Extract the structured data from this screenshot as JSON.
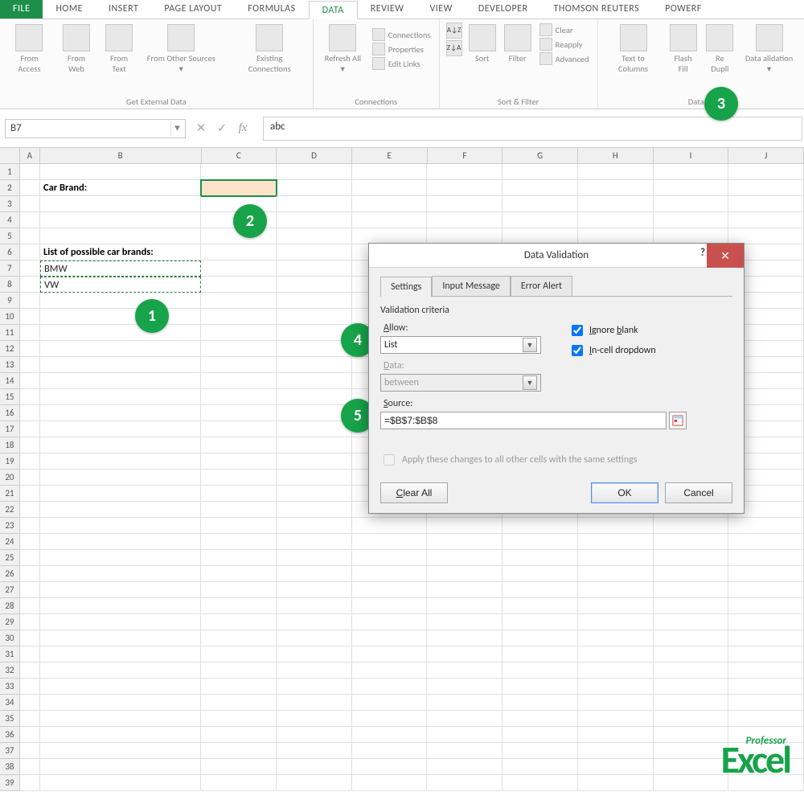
{
  "ribbon": {
    "tabs": [
      "FILE",
      "HOME",
      "INSERT",
      "PAGE LAYOUT",
      "FORMULAS",
      "DATA",
      "REVIEW",
      "VIEW",
      "DEVELOPER",
      "THOMSON REUTERS",
      "POWERF"
    ],
    "active": "DATA",
    "groups": {
      "external": {
        "label": "Get External Data",
        "items": [
          "From Access",
          "From Web",
          "From Text",
          "From Other Sources ▾",
          "Existing Connections"
        ]
      },
      "connections": {
        "label": "Connections",
        "refresh": "Refresh All ▾",
        "lines": [
          "Connections",
          "Properties",
          "Edit Links"
        ]
      },
      "sortfilter": {
        "label": "Sort & Filter",
        "sort": "Sort",
        "filter": "Filter",
        "lines": [
          "Clear",
          "Reapply",
          "Advanced"
        ]
      },
      "datatools": {
        "label": "Data To",
        "items": [
          "Text to Columns",
          "Flash Fill",
          "Re Dupli",
          "Data alidation ▾"
        ]
      }
    }
  },
  "fx": {
    "namebox": "B7",
    "formula": "abc"
  },
  "columns": [
    "A",
    "B",
    "C",
    "D",
    "E",
    "F",
    "G",
    "H",
    "I",
    "J"
  ],
  "cells": {
    "B2": "Car Brand:",
    "B6": "List of possible car brands:",
    "B7": "BMW",
    "B8": "VW"
  },
  "badges": {
    "1": "1",
    "2": "2",
    "3": "3",
    "4": "4",
    "5": "5"
  },
  "dialog": {
    "title": "Data Validation",
    "tabs": [
      "Settings",
      "Input Message",
      "Error Alert"
    ],
    "section": "Validation criteria",
    "allow_label": "Allow:",
    "allow_value": "List",
    "data_label": "Data:",
    "data_value": "between",
    "source_label": "Source:",
    "source_value": "=$B$7:$B$8",
    "ignore": "Ignore blank",
    "incell": "In-cell dropdown",
    "apply": "Apply these changes to all other cells with the same settings",
    "clear": "Clear All",
    "ok": "OK",
    "cancel": "Cancel"
  },
  "watermark": {
    "prof": "Professor",
    "excel": "Excel"
  }
}
